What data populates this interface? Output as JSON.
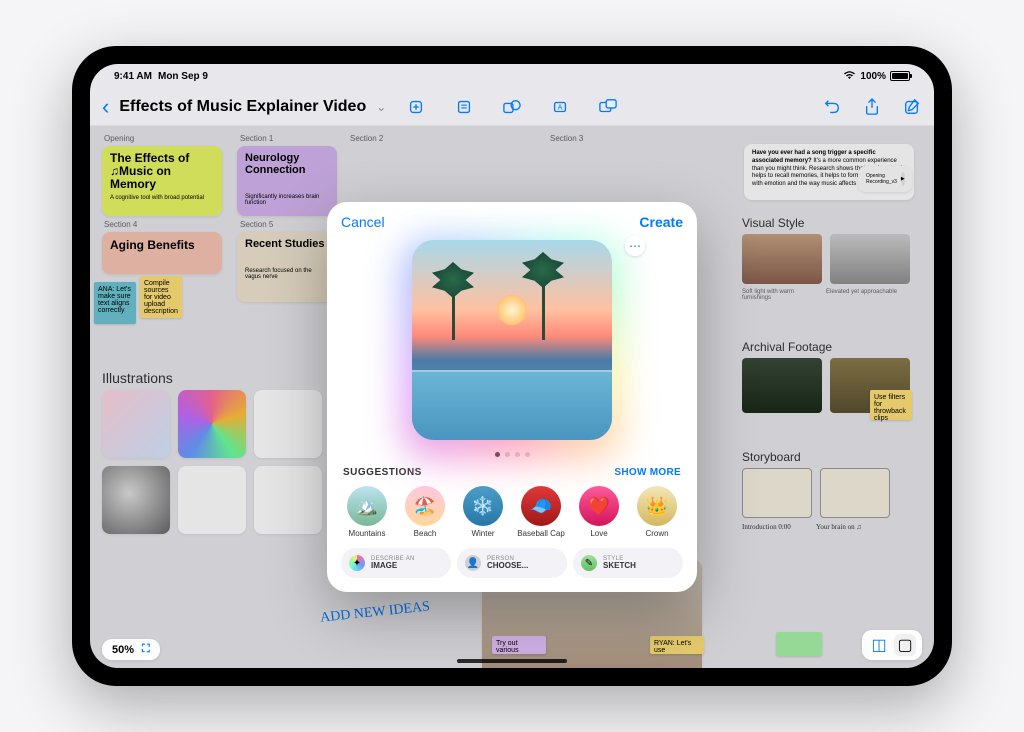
{
  "status": {
    "time": "9:41 AM",
    "date": "Mon Sep 9",
    "battery": "100%"
  },
  "nav": {
    "title": "Effects of Music Explainer Video"
  },
  "board": {
    "sections": [
      "Opening",
      "Section 1",
      "Section 2",
      "Section 3",
      "Section 4",
      "Section 5"
    ],
    "cards": {
      "opening": {
        "title": "The Effects of ♫Music on Memory",
        "sub": "A cognitive tool with broad potential"
      },
      "section1": {
        "title": "Neurology Connection",
        "sub": "Significantly increases brain function"
      },
      "section4": {
        "title": "Aging Benefits",
        "sub": ""
      },
      "section5": {
        "title": "Recent Studies",
        "sub": "Research focused on the vagus nerve"
      }
    },
    "stickies": {
      "teal": "ANA: Let's make sure text aligns correctly",
      "yellow": "Compile sources for video upload description",
      "paragraph_title": "Have you ever had a song trigger a specific associated memory?",
      "paragraph": "It's a more common experience than you might think. Research shows that music not only helps to recall memories, it helps to form them. It all starts with emotion and the way music affects the brain.",
      "ryan": "RYAN: Let's use",
      "tryout": "Try out various",
      "throwback": "Use filters for throwback clips",
      "storyboard1": "Introduction 0:00",
      "storyboard2": "Your brain on ♫"
    },
    "illustrations_title": "Illustrations",
    "visual_style_title": "Visual Style",
    "visual_captions": [
      "Soft light with warm furnishings",
      "Elevated yet approachable"
    ],
    "archival_title": "Archival Footage",
    "storyboard_title": "Storyboard",
    "handwriting": "ADD NEW IDEAS",
    "zoom": "50%",
    "recording_label": "Opening Recording_v3"
  },
  "modal": {
    "cancel": "Cancel",
    "create": "Create",
    "suggestions_label": "SUGGESTIONS",
    "show_more": "SHOW MORE",
    "suggestions": [
      {
        "label": "Mountains",
        "bg": "linear-gradient(180deg,#bde3f0,#7ab896)"
      },
      {
        "label": "Beach",
        "bg": "linear-gradient(180deg,#ffc8e0,#ffd89b)"
      },
      {
        "label": "Winter",
        "bg": "linear-gradient(180deg,#4a9ec8,#2877a8)"
      },
      {
        "label": "Baseball Cap",
        "bg": "linear-gradient(180deg,#e03838,#a01818)"
      },
      {
        "label": "Love",
        "bg": "linear-gradient(180deg,#ff5a9d,#d4145a)"
      },
      {
        "label": "Crown",
        "bg": "linear-gradient(180deg,#f5e6b8,#d4b860)"
      }
    ],
    "pills": {
      "describe": {
        "small": "DESCRIBE AN",
        "main": "IMAGE"
      },
      "person": {
        "small": "PERSON",
        "main": "CHOOSE..."
      },
      "style": {
        "small": "STYLE",
        "main": "SKETCH"
      }
    }
  }
}
